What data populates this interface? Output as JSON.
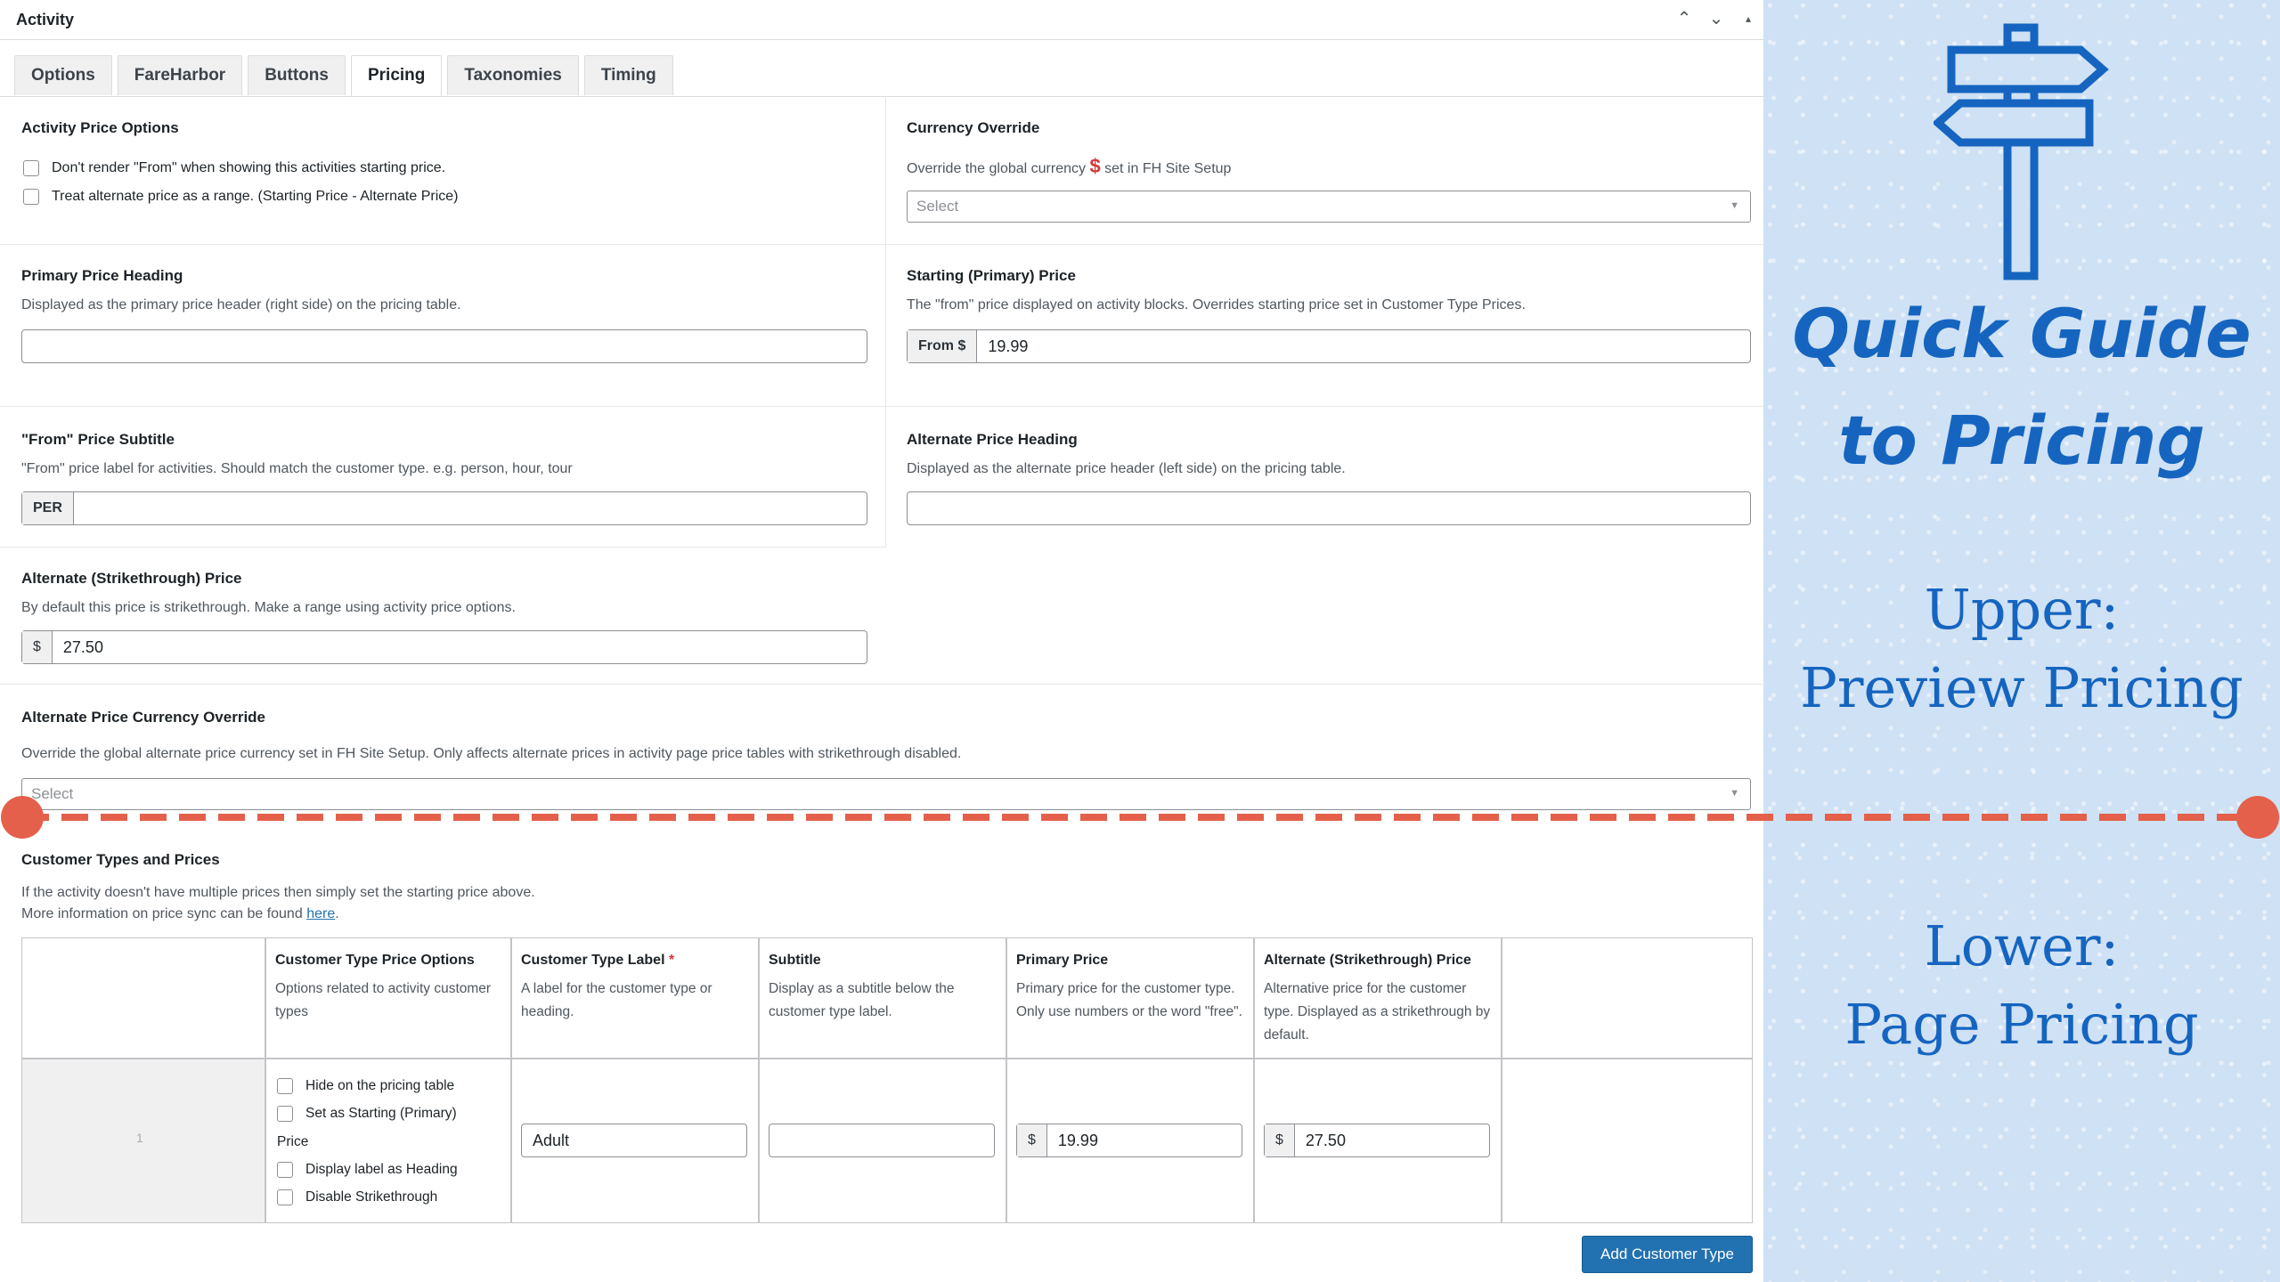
{
  "panel": {
    "title": "Activity",
    "controls": [
      "⌃",
      "⌄",
      "▴"
    ]
  },
  "tabs": [
    {
      "label": "Options"
    },
    {
      "label": "FareHarbor"
    },
    {
      "label": "Buttons"
    },
    {
      "label": "Pricing",
      "active": true
    },
    {
      "label": "Taxonomies"
    },
    {
      "label": "Timing"
    }
  ],
  "activity_price_options": {
    "label": "Activity Price Options",
    "checkboxes": [
      "Don't render \"From\" when showing this activities starting price.",
      "Treat alternate price as a range. (Starting Price - Alternate Price)"
    ]
  },
  "currency_override": {
    "label": "Currency Override",
    "desc_before": "Override the global currency",
    "symbol": "$",
    "desc_after": "set in FH Site Setup",
    "select_placeholder": "Select"
  },
  "primary_price_heading": {
    "label": "Primary Price Heading",
    "desc": "Displayed as the primary price header (right side) on the pricing table.",
    "value": ""
  },
  "starting_price": {
    "label": "Starting (Primary) Price",
    "desc": "The \"from\" price displayed on activity blocks. Overrides starting price set in Customer Type Prices.",
    "addon": "From $",
    "value": "19.99"
  },
  "from_subtitle": {
    "label": "\"From\" Price Subtitle",
    "desc": "\"From\" price label for activities. Should match the customer type. e.g. person, hour, tour",
    "addon": "PER",
    "value": ""
  },
  "alternate_heading": {
    "label": "Alternate Price Heading",
    "desc": "Displayed as the alternate price header (left side) on the pricing table.",
    "value": ""
  },
  "alternate_price": {
    "label": "Alternate (Strikethrough) Price",
    "desc": "By default this price is strikethrough. Make a range using activity price options.",
    "addon": "$",
    "value": "27.50"
  },
  "alt_currency_override": {
    "label": "Alternate Price Currency Override",
    "desc": "Override the global alternate price currency set in FH Site Setup. Only affects alternate prices in activity page price tables with strikethrough disabled.",
    "select_placeholder": "Select"
  },
  "customer_types": {
    "label": "Customer Types and Prices",
    "desc1": "If the activity doesn't have multiple prices then simply set the starting price above.",
    "desc2_before": "More information on price sync can be found",
    "desc2_link": "here",
    "desc2_after": ".",
    "columns": [
      {
        "title": "Customer Type Price Options",
        "desc": "Options related to activity customer types"
      },
      {
        "title": "Customer Type Label",
        "required": "*",
        "desc": "A label for the customer type or heading."
      },
      {
        "title": "Subtitle",
        "desc": "Display as a subtitle below the customer type label."
      },
      {
        "title": "Primary Price",
        "desc": "Primary price for the customer type. Only use numbers or the word \"free\"."
      },
      {
        "title": "Alternate (Strikethrough) Price",
        "desc": "Alternative price for the customer type. Displayed as a strikethrough by default."
      }
    ],
    "row": {
      "index": "1",
      "options": [
        "Hide on the pricing table",
        "Set as Starting (Primary)",
        "Display label as Heading",
        "Disable Strikethrough"
      ],
      "options_wrap": "Price",
      "label_value": "Adult",
      "subtitle_value": "",
      "primary_addon": "$",
      "primary_value": "19.99",
      "alternate_addon": "$",
      "alternate_value": "27.50"
    },
    "add_button": "Add Customer Type"
  },
  "side": {
    "title_line1": "Quick Guide",
    "title_line2": "to Pricing",
    "upper_line1": "Upper:",
    "upper_line2": "Preview Pricing",
    "lower_line1": "Lower:",
    "lower_line2": "Page Pricing",
    "colors": {
      "accent": "#1565c0",
      "divider": "#e4604a",
      "background": "#cfe1f4"
    }
  }
}
